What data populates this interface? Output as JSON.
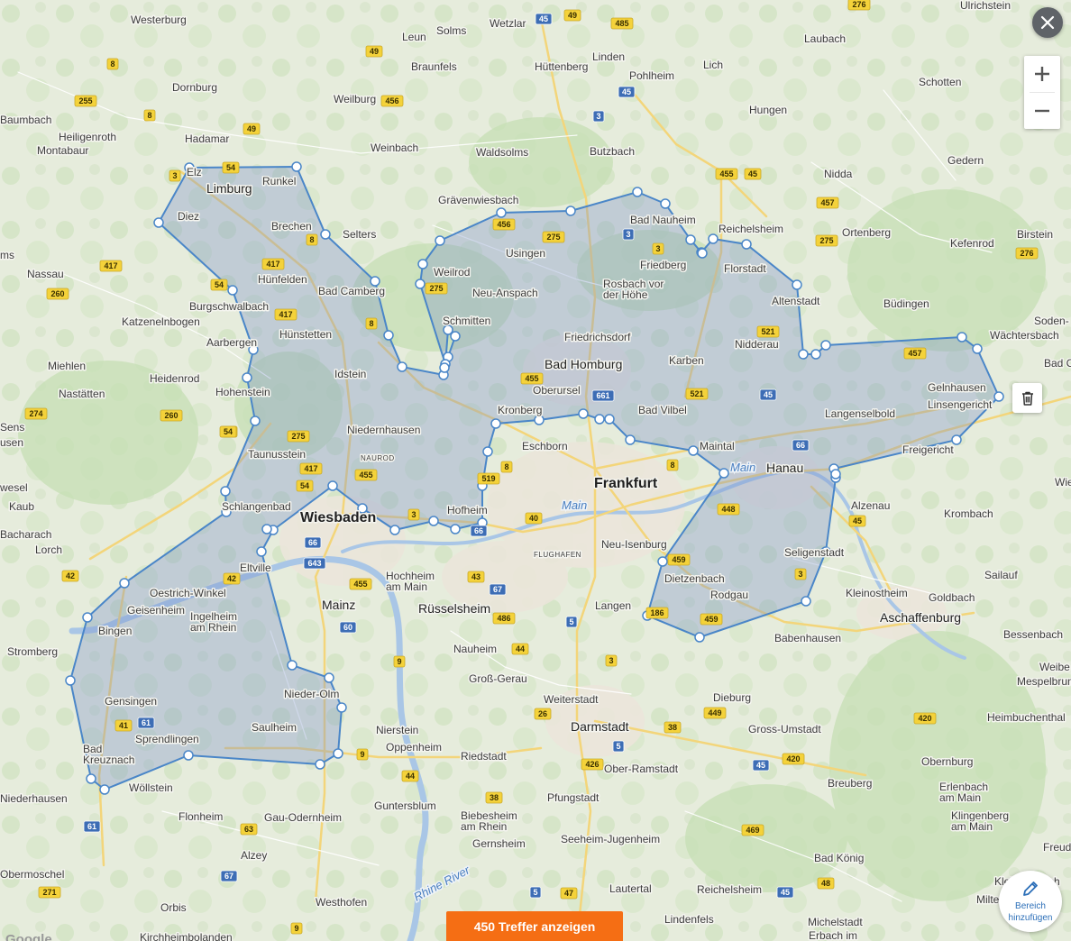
{
  "controls": {
    "close_icon": "close-icon",
    "zoom_in_icon": "plus-icon",
    "zoom_out_icon": "minus-icon",
    "trash_icon": "trash-icon",
    "add_area_icon": "pencil-icon",
    "add_area_label_line1": "Bereich",
    "add_area_label_line2": "hinzufügen",
    "results_button_label": "450 Treffer anzeigen"
  },
  "attribution": "Google",
  "colors": {
    "polygon_stroke": "#4a86c8",
    "polygon_fill": "#7b93c8",
    "results_button": "#f56e14",
    "autobahn_shield": "#3d6db5",
    "road_shield": "#f4d23a"
  },
  "cities_big": [
    "Frankfurt",
    "Wiesbaden",
    "Mainz",
    "Darmstadt",
    "Hanau",
    "Bad Homburg",
    "Aschaffenburg",
    "Limburg",
    "Rüsselsheim"
  ],
  "cities": [
    "Westerburg",
    "Wetzlar",
    "Ulrichstein",
    "Leun",
    "Solms",
    "Laubach",
    "Dornburg",
    "Braunfels",
    "Hüttenberg",
    "Linden",
    "Lich",
    "Schotten",
    "Pohlheim",
    "Baumbach",
    "Heiligenroth",
    "Montabaur",
    "Hadamar",
    "Weilburg",
    "Hungen",
    "Weinbach",
    "Waldsolms",
    "Butzbach",
    "Nidda",
    "Gedern",
    "Runkel",
    "Elz",
    "Diez",
    "Brechen",
    "Selters",
    "Grävenwiesbach",
    "Bad Nauheim",
    "Reichelsheim",
    "Ortenberg",
    "Birstein",
    "Kefenrod",
    "Nassau",
    "Hünfelden",
    "Usingen",
    "Friedberg",
    "Florstadt",
    "Weilrod",
    "Bad Camberg",
    "Neu-Anspach",
    "Rosbach vor\nder Höhe",
    "Altenstadt",
    "Büdingen",
    "Soden-",
    "Burgschwalbach",
    "Katzenelnbogen",
    "Schmitten",
    "Hünstetten",
    "Friedrichsdorf",
    "Nidderau",
    "Wächtersbach",
    "Aarbergen",
    "Idstein",
    "Karben",
    "Miehlen",
    "Heidenrod",
    "Oberursel",
    "Bad Vilbel",
    "Gelnhausen",
    "Linsengericht",
    "Nastätten",
    "Hohenstein",
    "Langenselbold",
    "Niedernhausen",
    "Kronberg",
    "Eschborn",
    "Maintal",
    "Freigericht",
    "Taunusstein",
    "Alzenau",
    "Kaub",
    "Schlangenbad",
    "Hofheim",
    "Krombach",
    "Bacharach",
    "Lorch",
    "Neu-Isenburg",
    "Seligenstadt",
    "Eltville",
    "Dietzenbach",
    "Sailauf",
    "Oestrich-Winkel",
    "Hochheim\nam Main",
    "Kleinostheim",
    "Goldbach",
    "Geisenheim",
    "Ingelheim\nam Rhein",
    "Rodgau",
    "Bingen",
    "Langen",
    "Babenhausen",
    "Bessenbach",
    "Stromberg",
    "Nauheim",
    "Weibe",
    "Mespelbrunn",
    "Groß-Gerau",
    "Dieburg",
    "Nieder-Olm",
    "Gensingen",
    "Weiterstadt",
    "Heimbuchenthal",
    "Gross-Umstadt",
    "Saulheim",
    "Nierstein",
    "Sprendlingen",
    "Oppenheim",
    "Bad\nKreuznach",
    "Riedstadt",
    "Ober-Ramstadt",
    "Obernburg",
    "Wöllstein",
    "Niederhausen",
    "Erlenbach\nam Main",
    "Breuberg",
    "Pfungstadt",
    "Guntersblum",
    "Flonheim",
    "Gau-Odernheim",
    "Biebesheim\nam Rhein",
    "Klingenberg\nam Main",
    "Gernsheim",
    "Seeheim-Jugenheim",
    "Freudenbe",
    "Alzey",
    "Bad König",
    "Obermoschel",
    "Kleinheubach",
    "Orbis",
    "Westhofen",
    "Lautertal",
    "Reichelsheim",
    "Milte",
    "Lindenfels",
    "Michelstadt",
    "Kirchheimbolanden",
    "Erbach im",
    "Bad Co",
    "Wie",
    "Sens",
    "usen",
    "wesel",
    "ms"
  ],
  "water_labels": [
    "Main",
    "Main",
    "Rhine River"
  ],
  "airport_label": "FLUGHAFEN",
  "district_label": "NAUROD",
  "road_shields": [
    "45",
    "49",
    "485",
    "276",
    "8",
    "49",
    "456",
    "255",
    "3",
    "49",
    "8",
    "45",
    "3",
    "54",
    "275",
    "455",
    "45",
    "275",
    "457",
    "276",
    "3",
    "417",
    "456",
    "8",
    "417",
    "54",
    "275",
    "8",
    "521",
    "260",
    "417",
    "457",
    "54",
    "455",
    "661",
    "521",
    "45",
    "274",
    "260",
    "275",
    "54",
    "3",
    "417",
    "455",
    "519",
    "8",
    "66",
    "54",
    "3",
    "66",
    "40",
    "8",
    "448",
    "45",
    "66",
    "643",
    "3",
    "459",
    "42",
    "455",
    "43",
    "67",
    "42",
    "486",
    "5",
    "186",
    "459",
    "60",
    "3",
    "44",
    "9",
    "41",
    "61",
    "26",
    "38",
    "449",
    "5",
    "426",
    "45",
    "420",
    "9",
    "44",
    "38",
    "469",
    "420",
    "61",
    "63",
    "67",
    "5",
    "47",
    "45",
    "48",
    "271",
    "9"
  ]
}
